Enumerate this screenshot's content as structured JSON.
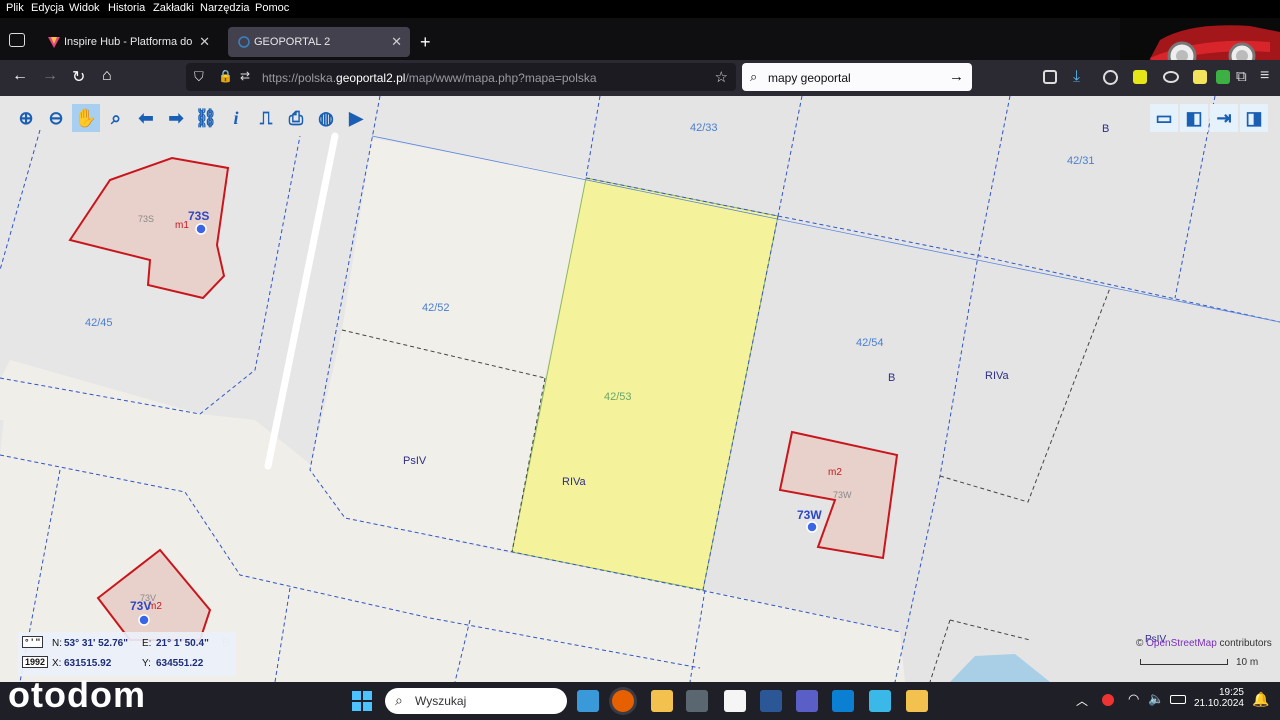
{
  "menu": [
    "Plik",
    "Edycja",
    "Widok",
    "Historia",
    "Zakładki",
    "Narzędzia",
    "Pomoc"
  ],
  "tabs": [
    {
      "title": "Inspire Hub - Platforma do pub",
      "close": "✕"
    },
    {
      "title": "GEOPORTAL 2",
      "close": "✕"
    }
  ],
  "newtab": "+",
  "address": {
    "prefix": "https://polska.",
    "domain": "geoportal2.pl",
    "suffix": "/map/www/mapa.php?mapa=polska"
  },
  "search": {
    "value": "mapy geoportal"
  },
  "map": {
    "parcels": [
      "42/33",
      "42/31",
      "42/52",
      "42/53",
      "42/54",
      "42/45"
    ],
    "landuse": [
      "B",
      "B",
      "PsIV",
      "RIVa",
      "RIVa",
      "PsIV",
      "B"
    ],
    "buildings": [
      {
        "type": "m1",
        "num": "73S",
        "addr": "73S"
      },
      {
        "type": "m2",
        "num": "73W",
        "addr": "73W"
      },
      {
        "type": "m2",
        "num": "73V",
        "addr": "73V"
      }
    ]
  },
  "coords": {
    "deg_box": "° ' ''",
    "n_label": "N:",
    "n_val": "53° 31' 52.76\"",
    "e_label": "E:",
    "e_val": "21° 1' 50.4\"",
    "sys_box": "1992",
    "x_label": "X:",
    "x_val": "631515.92",
    "y_label": "Y:",
    "y_val": "634551.22"
  },
  "credits": {
    "symbol": "©",
    "source": "OpenStreetMap",
    "suffix": "contributors"
  },
  "scale": {
    "label": "10 m"
  },
  "watermark": "otodom",
  "taskbar": {
    "search_placeholder": "Wyszukaj",
    "time": "19:25",
    "date": "21.10.2024"
  }
}
